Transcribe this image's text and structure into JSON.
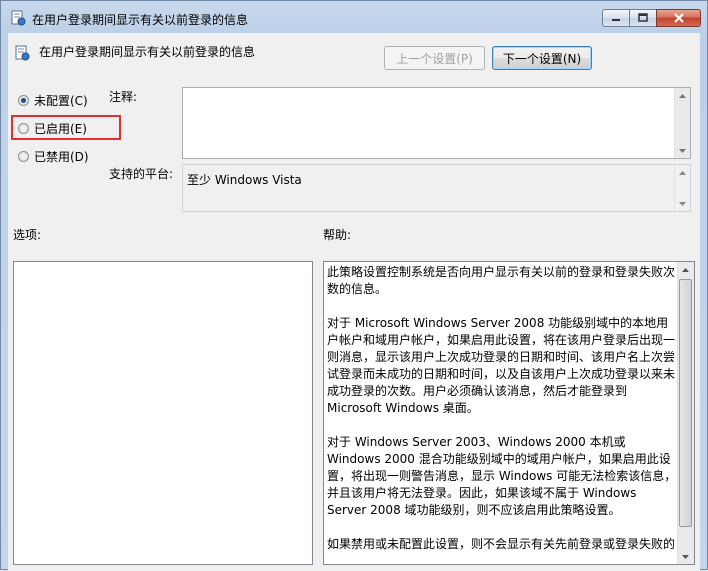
{
  "window": {
    "title": "在用户登录期间显示有关以前登录的信息"
  },
  "header": {
    "policy_name": "在用户登录期间显示有关以前登录的信息",
    "prev_button": "上一个设置(P)",
    "next_button": "下一个设置(N)"
  },
  "radios": [
    {
      "label": "未配置(C)",
      "selected": true
    },
    {
      "label": "已启用(E)",
      "selected": false
    },
    {
      "label": "已禁用(D)",
      "selected": false
    }
  ],
  "comment": {
    "label": "注释:",
    "value": ""
  },
  "platform": {
    "label": "支持的平台:",
    "value": "至少 Windows Vista"
  },
  "options": {
    "label": "选项:"
  },
  "help": {
    "label": "帮助:",
    "paragraphs": [
      "此策略设置控制系统是否向用户显示有关以前的登录和登录失败次数的信息。",
      "对于 Microsoft Windows Server 2008 功能级别域中的本地用户帐户和域用户帐户，如果启用此设置，将在该用户登录后出现一则消息，显示该用户上次成功登录的日期和时间、该用户名上次尝试登录而未成功的日期和时间，以及自该用户上次成功登录以来未成功登录的次数。用户必须确认该消息，然后才能登录到 Microsoft Windows 桌面。",
      "对于 Windows Server 2003、Windows 2000 本机或 Windows 2000 混合功能级别域中的域用户帐户，如果启用此设置，将出现一则警告消息，显示 Windows 可能无法检索该信息，并且该用户将无法登录。因此，如果该域不属于 Windows Server 2008 域功能级别，则不应该启用此策略设置。",
      "如果禁用或未配置此设置，则不会显示有关先前登录或登录失败的"
    ]
  },
  "colors": {
    "highlight_box": "#e03030",
    "selected_dot": "#1f4e84"
  }
}
